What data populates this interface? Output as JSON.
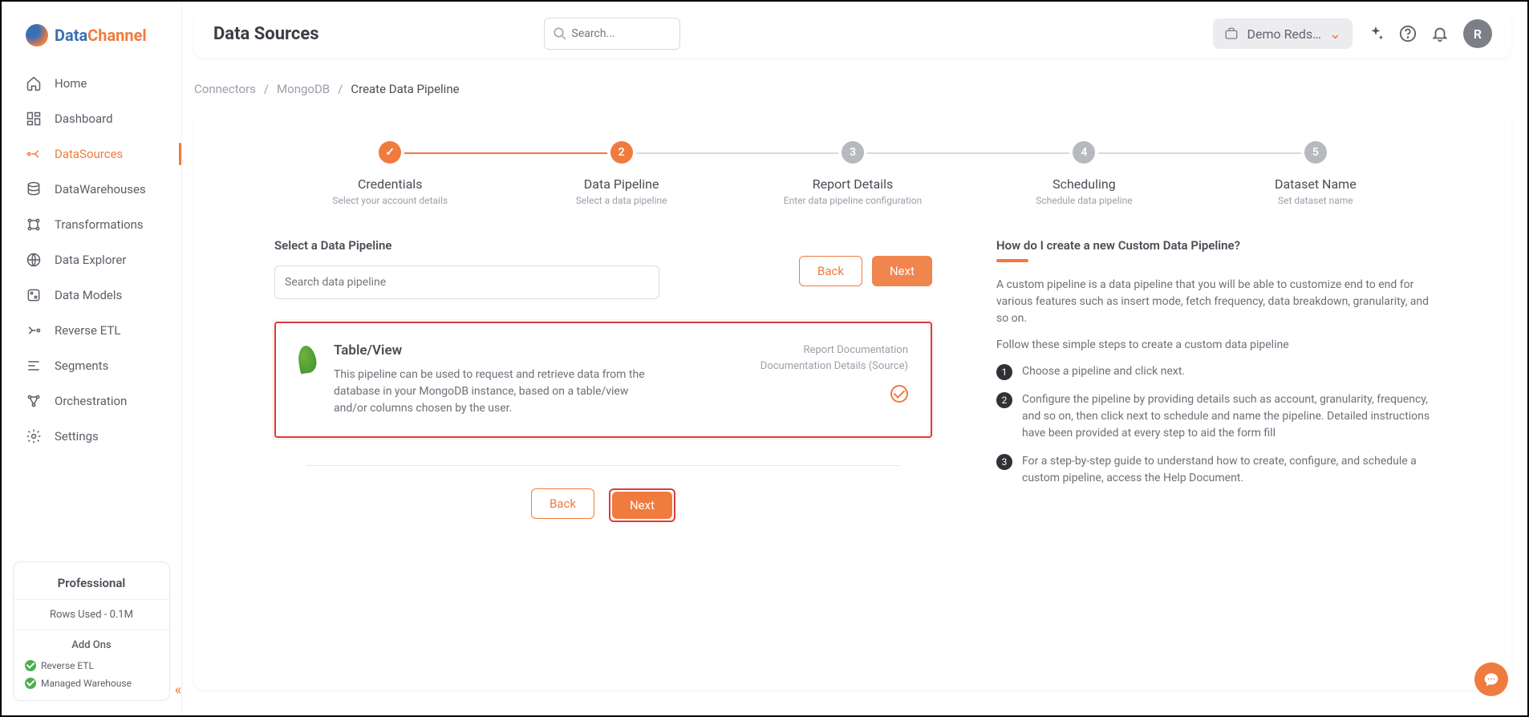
{
  "brand": {
    "part1": "Data",
    "part2": "Channel"
  },
  "topbar": {
    "title": "Data Sources",
    "search_placeholder": "Search...",
    "workspace_label": "Demo Reds…",
    "avatar_letter": "R"
  },
  "sidebar": {
    "items": [
      {
        "label": "Home"
      },
      {
        "label": "Dashboard"
      },
      {
        "label": "DataSources"
      },
      {
        "label": "DataWarehouses"
      },
      {
        "label": "Transformations"
      },
      {
        "label": "Data Explorer"
      },
      {
        "label": "Data Models"
      },
      {
        "label": "Reverse ETL"
      },
      {
        "label": "Segments"
      },
      {
        "label": "Orchestration"
      },
      {
        "label": "Settings"
      }
    ],
    "plan": {
      "title": "Professional",
      "rows_used": "Rows Used - 0.1M",
      "addons_title": "Add Ons",
      "addons": [
        "Reverse ETL",
        "Managed Warehouse"
      ]
    }
  },
  "breadcrumb": {
    "a": "Connectors",
    "b": "MongoDB",
    "c": "Create Data Pipeline"
  },
  "stepper": {
    "steps": [
      {
        "num": "✓",
        "title": "Credentials",
        "sub": "Select your account details"
      },
      {
        "num": "2",
        "title": "Data Pipeline",
        "sub": "Select a data pipeline"
      },
      {
        "num": "3",
        "title": "Report Details",
        "sub": "Enter data pipeline configuration"
      },
      {
        "num": "4",
        "title": "Scheduling",
        "sub": "Schedule data pipeline"
      },
      {
        "num": "5",
        "title": "Dataset Name",
        "sub": "Set dataset name"
      }
    ]
  },
  "pipeline": {
    "section_title": "Select a Data Pipeline",
    "search_placeholder": "Search data pipeline",
    "card": {
      "name": "Table/View",
      "desc": "This pipeline can be used to request and retrieve data from the database in your MongoDB instance, based on a table/view and/or columns chosen by the user.",
      "doc1": "Report Documentation",
      "doc2": "Documentation Details (Source)"
    },
    "btn_back": "Back",
    "btn_next": "Next"
  },
  "help": {
    "title": "How do I create a new Custom Data Pipeline?",
    "intro1": "A custom pipeline is a data pipeline that you will be able to customize end to end for various features such as insert mode, fetch frequency, data breakdown, granularity, and so on.",
    "intro2": "Follow these simple steps to create a custom data pipeline",
    "steps": [
      "Choose a pipeline and click next.",
      "Configure the pipeline by providing details such as account, granularity, frequency, and so on, then click next to schedule and name the pipeline. Detailed instructions have been provided at every step to aid the form fill",
      "For a step-by-step guide to understand how to create, configure, and schedule a custom pipeline, access the Help Document."
    ]
  }
}
